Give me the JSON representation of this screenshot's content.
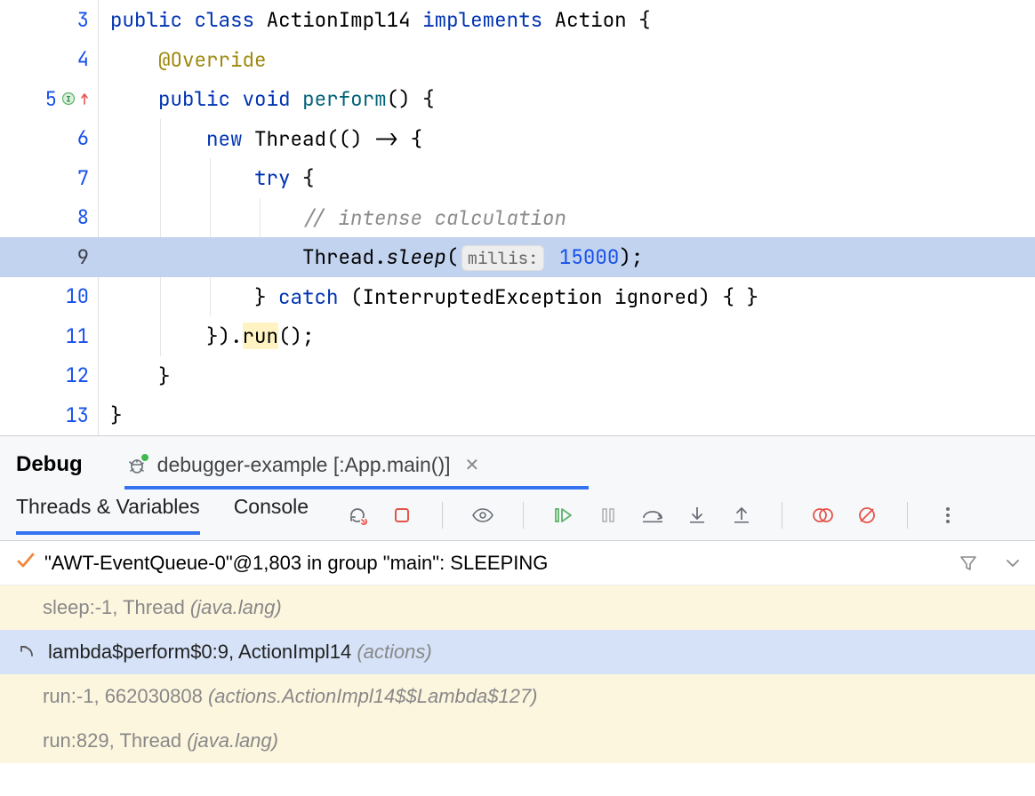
{
  "editor": {
    "lines": [
      {
        "n": "3",
        "kind": "plain"
      },
      {
        "n": "4",
        "kind": "plain"
      },
      {
        "n": "5",
        "kind": "plain",
        "marker": "implements-up"
      },
      {
        "n": "6",
        "kind": "plain"
      },
      {
        "n": "7",
        "kind": "plain"
      },
      {
        "n": "8",
        "kind": "plain"
      },
      {
        "n": "9",
        "kind": "highlight"
      },
      {
        "n": "10",
        "kind": "plain"
      },
      {
        "n": "11",
        "kind": "plain"
      },
      {
        "n": "12",
        "kind": "plain"
      },
      {
        "n": "13",
        "kind": "plain"
      }
    ],
    "tokens": {
      "kw_public": "public",
      "kw_class": "class",
      "t_ActionImpl14": "ActionImpl14",
      "kw_implements": "implements",
      "t_Action": "Action",
      "brace_open": "{",
      "brace_close": "}",
      "ann_override": "@Override",
      "kw_void": "void",
      "m_perform": "perform",
      "parens": "()",
      "kw_new": "new",
      "t_Thread": "Thread",
      "lambda_open": "(() -> {",
      "kw_try": "try",
      "comment_calc": "// intense calculation",
      "call_Thread": "Thread.",
      "m_sleep": "sleep",
      "hint_millis": "millis:",
      "v_15000": "15000",
      "close_paren_semi": ");",
      "kw_catch": "catch",
      "catch_sig": "(InterruptedException ignored) { }",
      "run_close_prefix": "}).",
      "m_run": "run",
      "run_close_suffix": "();"
    }
  },
  "debug": {
    "title": "Debug",
    "tab_label": "debugger-example [:App.main()]",
    "tabs": {
      "threads": "Threads & Variables",
      "console": "Console"
    },
    "thread_row": "\"AWT-EventQueue-0\"@1,803 in group \"main\": SLEEPING",
    "frames": [
      {
        "name": "sleep:-1, Thread ",
        "loc": "(java.lang)",
        "style": "odd"
      },
      {
        "name": "lambda$perform$0:9, ActionImpl14 ",
        "loc": "(actions)",
        "style": "sel",
        "icon": "undo"
      },
      {
        "name": "run:-1, 662030808 ",
        "loc": "(actions.ActionImpl14$$Lambda$127)",
        "style": "odd"
      },
      {
        "name": "run:829, Thread ",
        "loc": "(java.lang)",
        "style": "odd"
      }
    ]
  }
}
